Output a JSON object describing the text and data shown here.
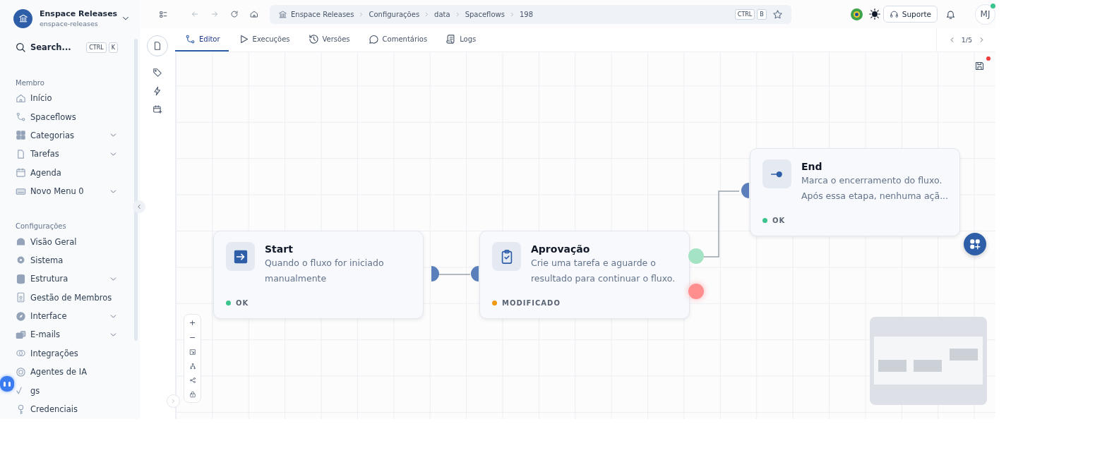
{
  "workspace": {
    "title": "Enspace Releases",
    "slug": "enspace-releases"
  },
  "search": {
    "placeholder": "Search...",
    "shortcut": [
      "CTRL",
      "K"
    ]
  },
  "sidebar": {
    "sections": [
      {
        "label": "Membro",
        "items": [
          {
            "label": "Início",
            "has_submenu": false
          },
          {
            "label": "Spaceflows",
            "has_submenu": false
          },
          {
            "label": "Categorias",
            "has_submenu": true
          },
          {
            "label": "Tarefas",
            "has_submenu": true
          },
          {
            "label": "Agenda",
            "has_submenu": false
          },
          {
            "label": "Novo Menu 0",
            "has_submenu": true
          }
        ]
      },
      {
        "label": "Configurações",
        "items": [
          {
            "label": "Visão Geral",
            "has_submenu": false
          },
          {
            "label": "Sistema",
            "has_submenu": false
          },
          {
            "label": "Estrutura",
            "has_submenu": true
          },
          {
            "label": "Gestão de Membros",
            "has_submenu": false
          },
          {
            "label": "Interface",
            "has_submenu": true
          },
          {
            "label": "E-mails",
            "has_submenu": true
          },
          {
            "label": "Integrações",
            "has_submenu": false
          },
          {
            "label": "Agentes de IA",
            "has_submenu": false
          },
          {
            "label": "gs",
            "has_submenu": false
          },
          {
            "label": "Credenciais",
            "has_submenu": false
          }
        ]
      }
    ]
  },
  "breadcrumb": [
    "Enspace Releases",
    "Configurações",
    "data",
    "Spaceflows",
    "198"
  ],
  "bookmark_shortcut": [
    "CTRL",
    "B"
  ],
  "support_button": "Suporte",
  "user": {
    "initials": "MJ"
  },
  "tabs": [
    {
      "label": "Editor",
      "selected": true
    },
    {
      "label": "Execuções",
      "selected": false
    },
    {
      "label": "Versões",
      "selected": false
    },
    {
      "label": "Comentários",
      "selected": false
    },
    {
      "label": "Logs",
      "selected": false
    }
  ],
  "pager": "1/5",
  "nodes": [
    {
      "kind": "start",
      "title": "Start",
      "description": "Quando o fluxo for iniciado manualmente",
      "status": "OK",
      "color": "#3cc48e"
    },
    {
      "kind": "approval",
      "title": "Aprovação",
      "description": "Crie uma tarefa e aguarde o resultado para continuar o fluxo.",
      "status": "MODIFICADO",
      "color": "#f09a12"
    },
    {
      "kind": "end",
      "title": "End",
      "description": "Marca o encerramento do fluxo. Após essa etapa, nenhuma açã...",
      "status": "OK",
      "color": "#3cc48e"
    }
  ],
  "zoom_controls": [
    "+",
    "−"
  ]
}
